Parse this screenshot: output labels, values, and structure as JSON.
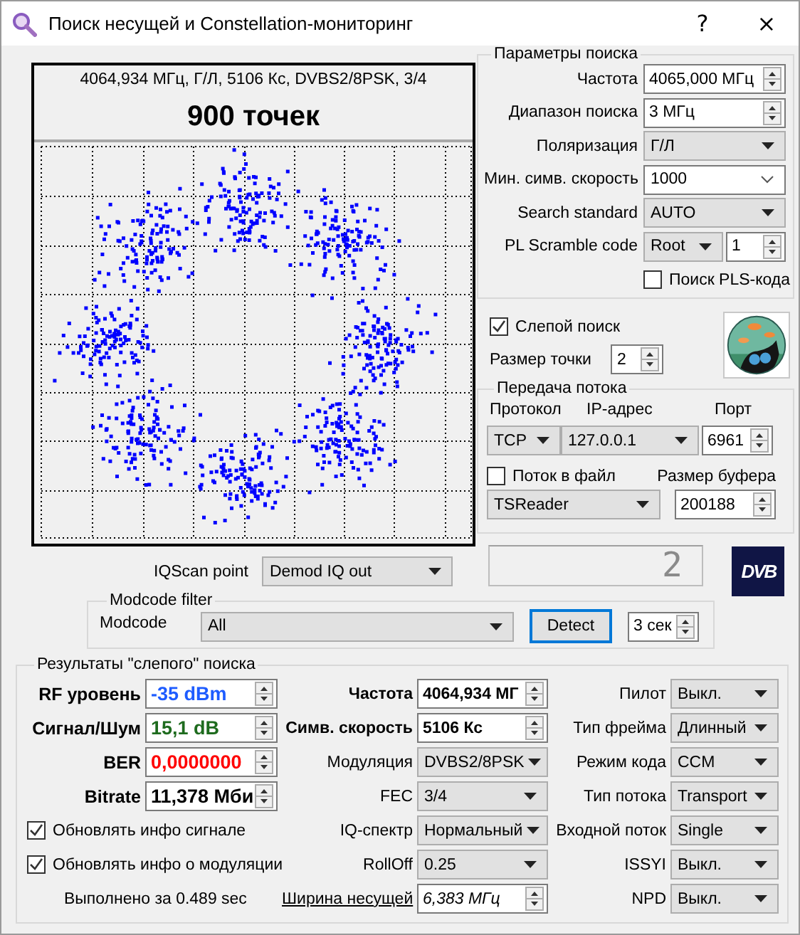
{
  "window": {
    "title": "Поиск несущей и Constellation-мониторинг",
    "help_button": "?",
    "close_button": "×"
  },
  "scope": {
    "info": "4064,934 МГц, Г/Л, 5106 Кс, DVBS2/8PSK, 3/4",
    "count": "900 точек"
  },
  "search_params": {
    "title": "Параметры поиска",
    "rows": [
      {
        "label": "Частота",
        "kind": "spin",
        "value": "4065,000 МГц"
      },
      {
        "label": "Диапазон поиска",
        "kind": "spin",
        "value": "3 МГц"
      },
      {
        "label": "Поляризация",
        "kind": "combo",
        "value": "Г/Л"
      },
      {
        "label": "Мин. симв. скорость",
        "kind": "edit-combo",
        "value": "1000"
      },
      {
        "label": "Search standard",
        "kind": "combo",
        "value": "AUTO"
      },
      {
        "label": "PL Scramble code",
        "kind": "combo-spin",
        "value": "Root",
        "value_2": "1"
      }
    ],
    "pls_search": {
      "label": "Поиск PLS-кода",
      "checked": false
    }
  },
  "blind_search": {
    "label": "Слепой поиск",
    "checked": true
  },
  "dot_size": {
    "label": "Размер точки",
    "value": "2"
  },
  "stream": {
    "title": "Передача потока",
    "headers": [
      "Протокол",
      "IP-адрес",
      "Порт"
    ],
    "protocol": "TCP",
    "ip": "127.0.0.1",
    "port": "6961",
    "to_file": {
      "label": "Поток в файл",
      "checked": false
    },
    "buffer_label": "Размер буфера",
    "reader": "TSReader",
    "buffer": "200188"
  },
  "iqscan": {
    "label": "IQScan point",
    "value": "Demod IQ out"
  },
  "lcd": "2",
  "logo": "DVB",
  "modcode_filter": {
    "title": "Modcode filter",
    "label": "Modcode",
    "value": "All",
    "detect_button": "Detect",
    "seconds": "3 сек"
  },
  "results": {
    "title": "Результаты \"слепого\" поиска",
    "meters": [
      {
        "label": "RF уровень",
        "value": "-35 dBm",
        "color": "#1e5cff"
      },
      {
        "label": "Сигнал/Шум",
        "value": "15,1 dB",
        "color": "#1e6b1e"
      },
      {
        "label": "BER",
        "value": "0,0000000",
        "color": "#ff0000"
      },
      {
        "label": "Bitrate",
        "value": "11,378 Мби",
        "color": "#000000"
      }
    ],
    "checkboxes": [
      {
        "label": "Обновлять инфо сигнале",
        "checked": true
      },
      {
        "label": "Обновлять инфо о модуляции",
        "checked": true
      }
    ],
    "elapsed": "Выполнено за 0.489 sec",
    "signal_params": [
      {
        "label": "Частота",
        "kind": "bold-spin",
        "value": "4064,934 МГ"
      },
      {
        "label": "Симв. скорость",
        "kind": "bold-spin",
        "value": "5106 Кс"
      },
      {
        "label": "Модуляция",
        "kind": "combo",
        "value": "DVBS2/8PSK"
      },
      {
        "label": "FEC",
        "kind": "combo",
        "value": "3/4"
      },
      {
        "label": "IQ-спектр",
        "kind": "combo",
        "value": "Нормальный"
      },
      {
        "label": "RollOff",
        "kind": "combo",
        "value": "0.25"
      },
      {
        "label": "Ширина несущей",
        "kind": "link-spin",
        "value": "6,383 МГц"
      }
    ],
    "stream_params": [
      {
        "label": "Пилот",
        "value": "Выкл."
      },
      {
        "label": "Тип фрейма",
        "value": "Длинный"
      },
      {
        "label": "Режим кода",
        "value": "CCM"
      },
      {
        "label": "Тип потока",
        "value": "Transport"
      },
      {
        "label": "Входной поток",
        "value": "Single"
      },
      {
        "label": "ISSYI",
        "value": "Выкл."
      },
      {
        "label": "NPD",
        "value": "Выкл."
      }
    ]
  }
}
